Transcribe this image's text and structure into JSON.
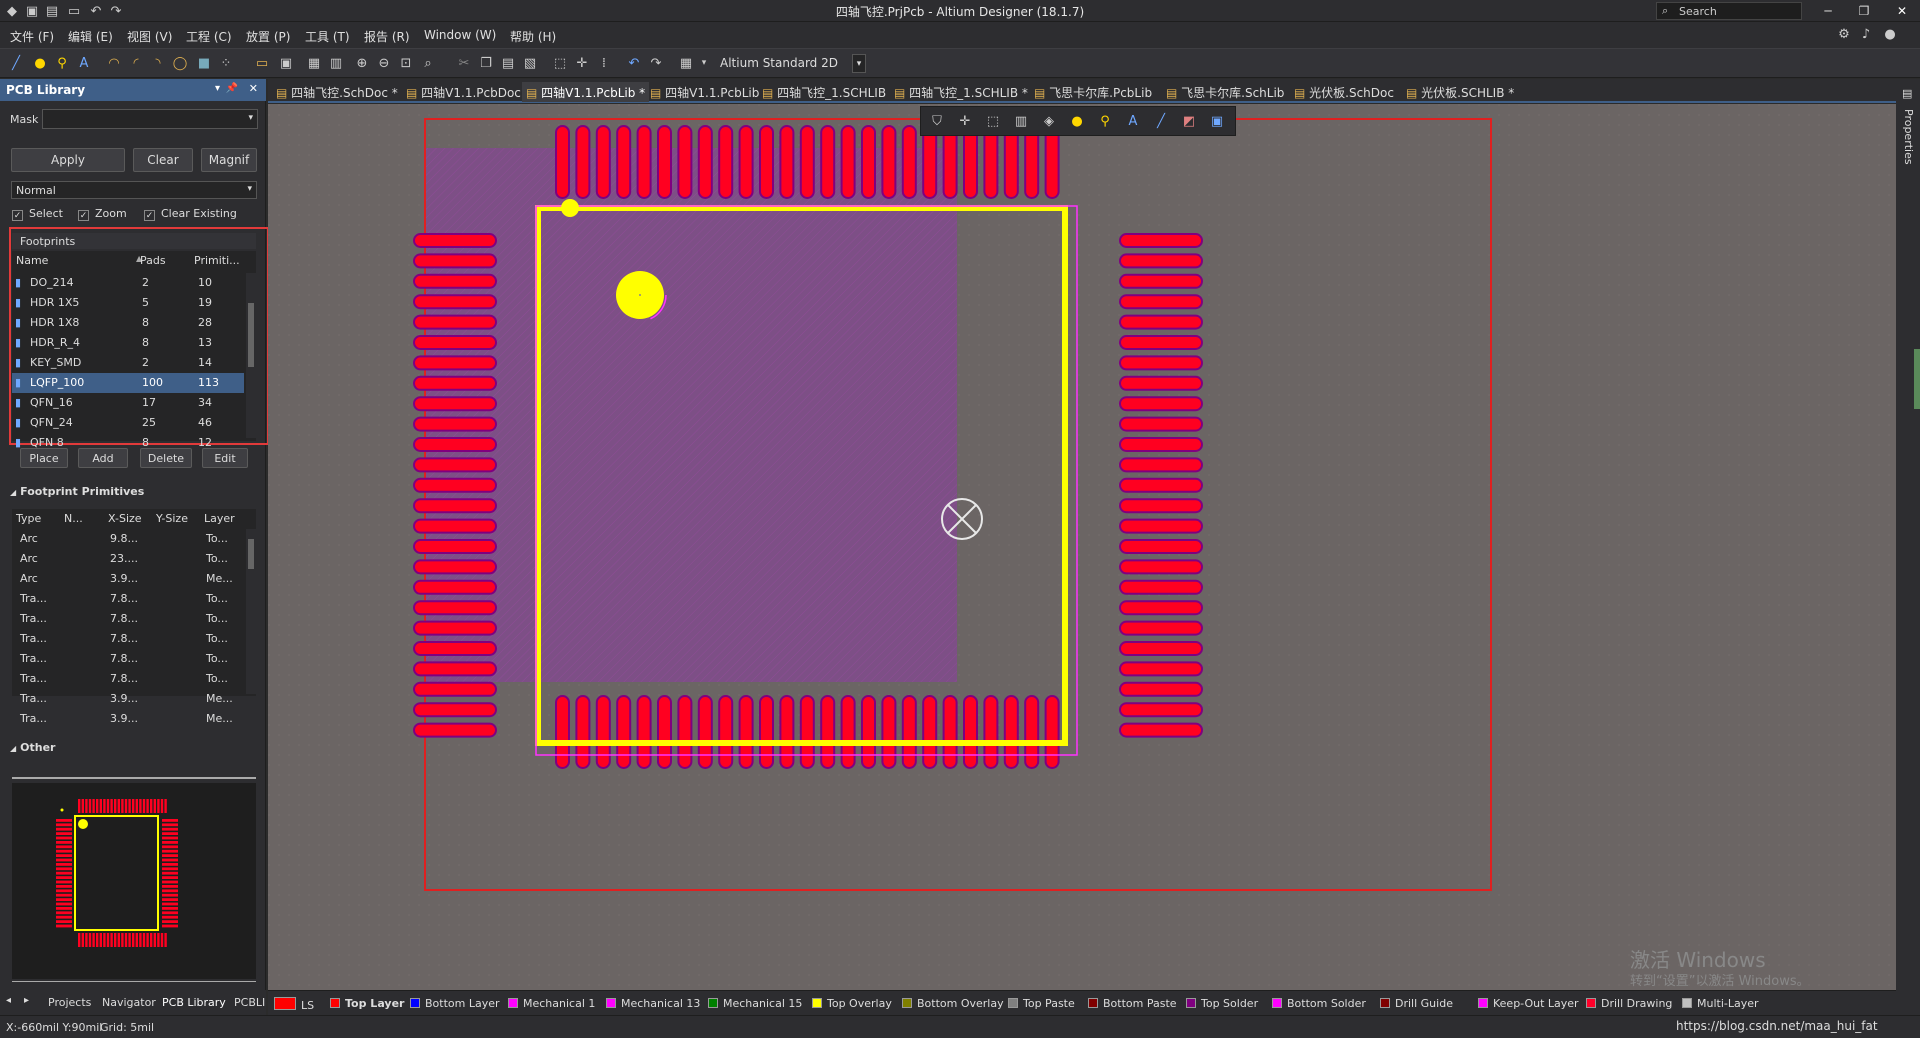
{
  "title": "四轴飞控.PrjPcb - Altium Designer (18.1.7)",
  "search_placeholder": "Search",
  "menus": [
    "文件 (F)",
    "编辑 (E)",
    "视图 (V)",
    "工程 (C)",
    "放置 (P)",
    "工具 (T)",
    "报告 (R)",
    "Window (W)",
    "帮助 (H)"
  ],
  "toolbar": {
    "view_mode": "Altium Standard 2D"
  },
  "panel": {
    "title": "PCB Library",
    "mask_label": "Mask",
    "mask_value": "",
    "buttons": {
      "apply": "Apply",
      "clear": "Clear",
      "magnify": "Magnif"
    },
    "filter_mode": "Normal",
    "checks": {
      "select": "Select",
      "zoom": "Zoom",
      "clear_existing": "Clear Existing"
    },
    "footprints": {
      "title": "Footprints",
      "headers": [
        "Name",
        "Pads",
        "Primiti..."
      ],
      "rows": [
        {
          "name": "DO_214",
          "pads": "2",
          "prims": "10"
        },
        {
          "name": "HDR 1X5",
          "pads": "5",
          "prims": "19"
        },
        {
          "name": "HDR 1X8",
          "pads": "8",
          "prims": "28"
        },
        {
          "name": "HDR_R_4",
          "pads": "8",
          "prims": "13"
        },
        {
          "name": "KEY_SMD",
          "pads": "2",
          "prims": "14"
        },
        {
          "name": "LQFP_100",
          "pads": "100",
          "prims": "113"
        },
        {
          "name": "QFN_16",
          "pads": "17",
          "prims": "34"
        },
        {
          "name": "QFN_24",
          "pads": "25",
          "prims": "46"
        },
        {
          "name": "QFN 8",
          "pads": "8",
          "prims": "12"
        }
      ],
      "selected_index": 5,
      "actions": {
        "place": "Place",
        "add": "Add",
        "delete": "Delete",
        "edit": "Edit"
      }
    },
    "primitives": {
      "title": "Footprint Primitives",
      "headers": [
        "Type",
        "N...",
        "X-Size",
        "Y-Size",
        "Layer"
      ],
      "rows": [
        {
          "type": "Arc",
          "x": "9.8...",
          "layer": "To..."
        },
        {
          "type": "Arc",
          "x": "23....",
          "layer": "To..."
        },
        {
          "type": "Arc",
          "x": "3.9...",
          "layer": "Me..."
        },
        {
          "type": "Tra...",
          "x": "7.8...",
          "layer": "To..."
        },
        {
          "type": "Tra...",
          "x": "7.8...",
          "layer": "To..."
        },
        {
          "type": "Tra...",
          "x": "7.8...",
          "layer": "To..."
        },
        {
          "type": "Tra...",
          "x": "7.8...",
          "layer": "To..."
        },
        {
          "type": "Tra...",
          "x": "7.8...",
          "layer": "To..."
        },
        {
          "type": "Tra...",
          "x": "3.9...",
          "layer": "Me..."
        },
        {
          "type": "Tra...",
          "x": "3.9...",
          "layer": "Me..."
        }
      ]
    },
    "other_title": "Other",
    "bottom_tabs": [
      "Projects",
      "Navigator",
      "PCB Library",
      "PCBLI"
    ]
  },
  "doc_tabs": [
    {
      "label": "四轴飞控.SchDoc *",
      "active": false
    },
    {
      "label": "四轴V1.1.PcbDoc",
      "active": false
    },
    {
      "label": "四轴V1.1.PcbLib *",
      "active": true
    },
    {
      "label": "四轴V1.1.PcbLib",
      "active": false
    },
    {
      "label": "四轴飞控_1.SCHLIB",
      "active": false
    },
    {
      "label": "四轴飞控_1.SCHLIB *",
      "active": false
    },
    {
      "label": "飞思卡尔库.PcbLib",
      "active": false
    },
    {
      "label": "飞思卡尔库.SchLib",
      "active": false
    },
    {
      "label": "光伏板.SchDoc",
      "active": false
    },
    {
      "label": "光伏板.SCHLIB *",
      "active": false
    }
  ],
  "right_strip_label": "Properties",
  "layers": [
    {
      "label": "LS",
      "color": "#ff0000"
    },
    {
      "label": "Top Layer",
      "color": "#ff0000"
    },
    {
      "label": "Bottom Layer",
      "color": "#0000ff"
    },
    {
      "label": "Mechanical 1",
      "color": "#ff00ff"
    },
    {
      "label": "Mechanical 13",
      "color": "#ff00ff"
    },
    {
      "label": "Mechanical 15",
      "color": "#008000"
    },
    {
      "label": "Top Overlay",
      "color": "#ffff00"
    },
    {
      "label": "Bottom Overlay",
      "color": "#808000"
    },
    {
      "label": "Top Paste",
      "color": "#808080"
    },
    {
      "label": "Bottom Paste",
      "color": "#800000"
    },
    {
      "label": "Top Solder",
      "color": "#800080"
    },
    {
      "label": "Bottom Solder",
      "color": "#ff00ff"
    },
    {
      "label": "Drill Guide",
      "color": "#800000"
    },
    {
      "label": "Keep-Out Layer",
      "color": "#ff00ff"
    },
    {
      "label": "Drill Drawing",
      "color": "#ff002a"
    },
    {
      "label": "Multi-Layer",
      "color": "#c0c0c0"
    }
  ],
  "status": {
    "coords": "X:-660mil Y:90mil",
    "grid": "Grid: 5mil"
  },
  "watermark": {
    "line1": "激活 Windows",
    "line2": "转到“设置”以激活 Windows。",
    "url": "https://blog.csdn.net/maa_hui_fat"
  },
  "colors": {
    "pad": "#ff0020",
    "pad_outline": "#800080",
    "overlay": "#ffff00",
    "canvas": "#6b6564",
    "accent": "#3f5f88",
    "boundary": "#e02020"
  }
}
